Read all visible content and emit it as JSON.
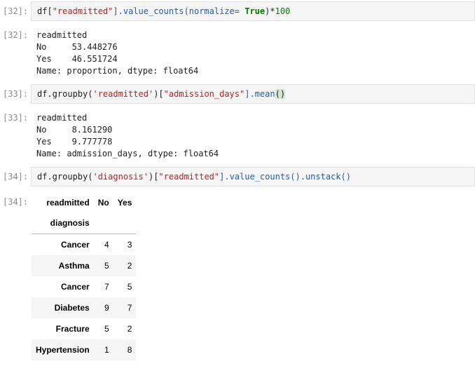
{
  "cells": [
    {
      "in_prompt": "[32]:",
      "code": {
        "prefix": "df[",
        "key": "\"readmitted\"",
        "mid": "].value_counts(normalize= ",
        "kw": "True",
        "suffix": ")*",
        "num": "100"
      },
      "out_prompt": "[32]:",
      "output": "readmitted\nNo     53.448276\nYes    46.551724\nName: proportion, dtype: float64"
    },
    {
      "in_prompt": "[33]:",
      "code": {
        "a": "df.groupby(",
        "b": "'readmitted'",
        "c": ")[",
        "d": "\"admission_days\"",
        "e": "].mean",
        "f": "()"
      },
      "out_prompt": "[33]:",
      "output": "readmitted\nNo     8.161290\nYes    9.777778\nName: admission_days, dtype: float64"
    },
    {
      "in_prompt": "[34]:",
      "code": {
        "a": "df.groupby(",
        "b": "'diagnosis'",
        "c": ")[",
        "d": "\"readmitted\"",
        "e": "].value_counts().unstack()"
      },
      "out_prompt": "[34]:",
      "table": {
        "column_axis_name": "readmitted",
        "columns": [
          "No",
          "Yes"
        ],
        "index_name": "diagnosis",
        "rows": [
          {
            "index": "Cancer",
            "values": [
              "4",
              "3"
            ]
          },
          {
            "index": "Asthma",
            "values": [
              "5",
              "2"
            ]
          },
          {
            "index": "Cancer",
            "values": [
              "7",
              "5"
            ]
          },
          {
            "index": "Diabetes",
            "values": [
              "9",
              "7"
            ]
          },
          {
            "index": "Fracture",
            "values": [
              "5",
              "2"
            ]
          },
          {
            "index": "Hypertension",
            "values": [
              "1",
              "8"
            ]
          }
        ]
      }
    }
  ]
}
